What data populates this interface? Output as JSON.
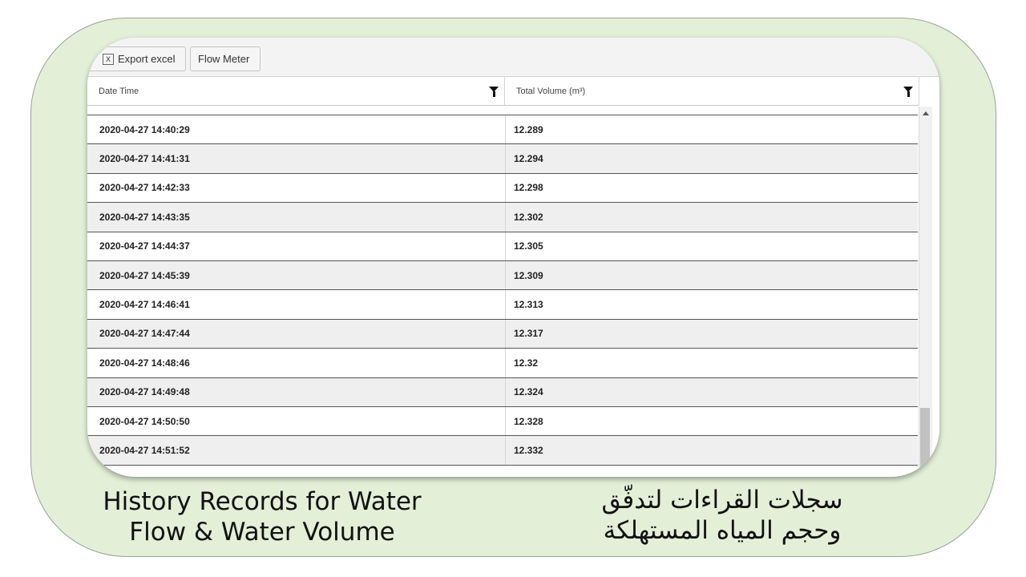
{
  "toolbar": {
    "export_icon": "X",
    "export_label": "Export excel",
    "flow_meter_label": "Flow Meter"
  },
  "table": {
    "columns": [
      "Date Time",
      "Total Volume (m³)"
    ],
    "rows": [
      {
        "datetime": "2020-04-27 14:40:29",
        "volume": "12.289"
      },
      {
        "datetime": "2020-04-27 14:41:31",
        "volume": "12.294"
      },
      {
        "datetime": "2020-04-27 14:42:33",
        "volume": "12.298"
      },
      {
        "datetime": "2020-04-27 14:43:35",
        "volume": "12.302"
      },
      {
        "datetime": "2020-04-27 14:44:37",
        "volume": "12.305"
      },
      {
        "datetime": "2020-04-27 14:45:39",
        "volume": "12.309"
      },
      {
        "datetime": "2020-04-27 14:46:41",
        "volume": "12.313"
      },
      {
        "datetime": "2020-04-27 14:47:44",
        "volume": "12.317"
      },
      {
        "datetime": "2020-04-27 14:48:46",
        "volume": "12.32"
      },
      {
        "datetime": "2020-04-27 14:49:48",
        "volume": "12.324"
      },
      {
        "datetime": "2020-04-27 14:50:50",
        "volume": "12.328"
      },
      {
        "datetime": "2020-04-27 14:51:52",
        "volume": "12.332"
      }
    ]
  },
  "captions": {
    "english_line1": "History Records for Water",
    "english_line2": "Flow & Water Volume",
    "arabic_line1": "سجلات القراءات لتدفّق",
    "arabic_line2": "وحجم المياه المستهلكة"
  },
  "colors": {
    "card_background": "#e3efd7",
    "row_alt": "#efefef"
  }
}
